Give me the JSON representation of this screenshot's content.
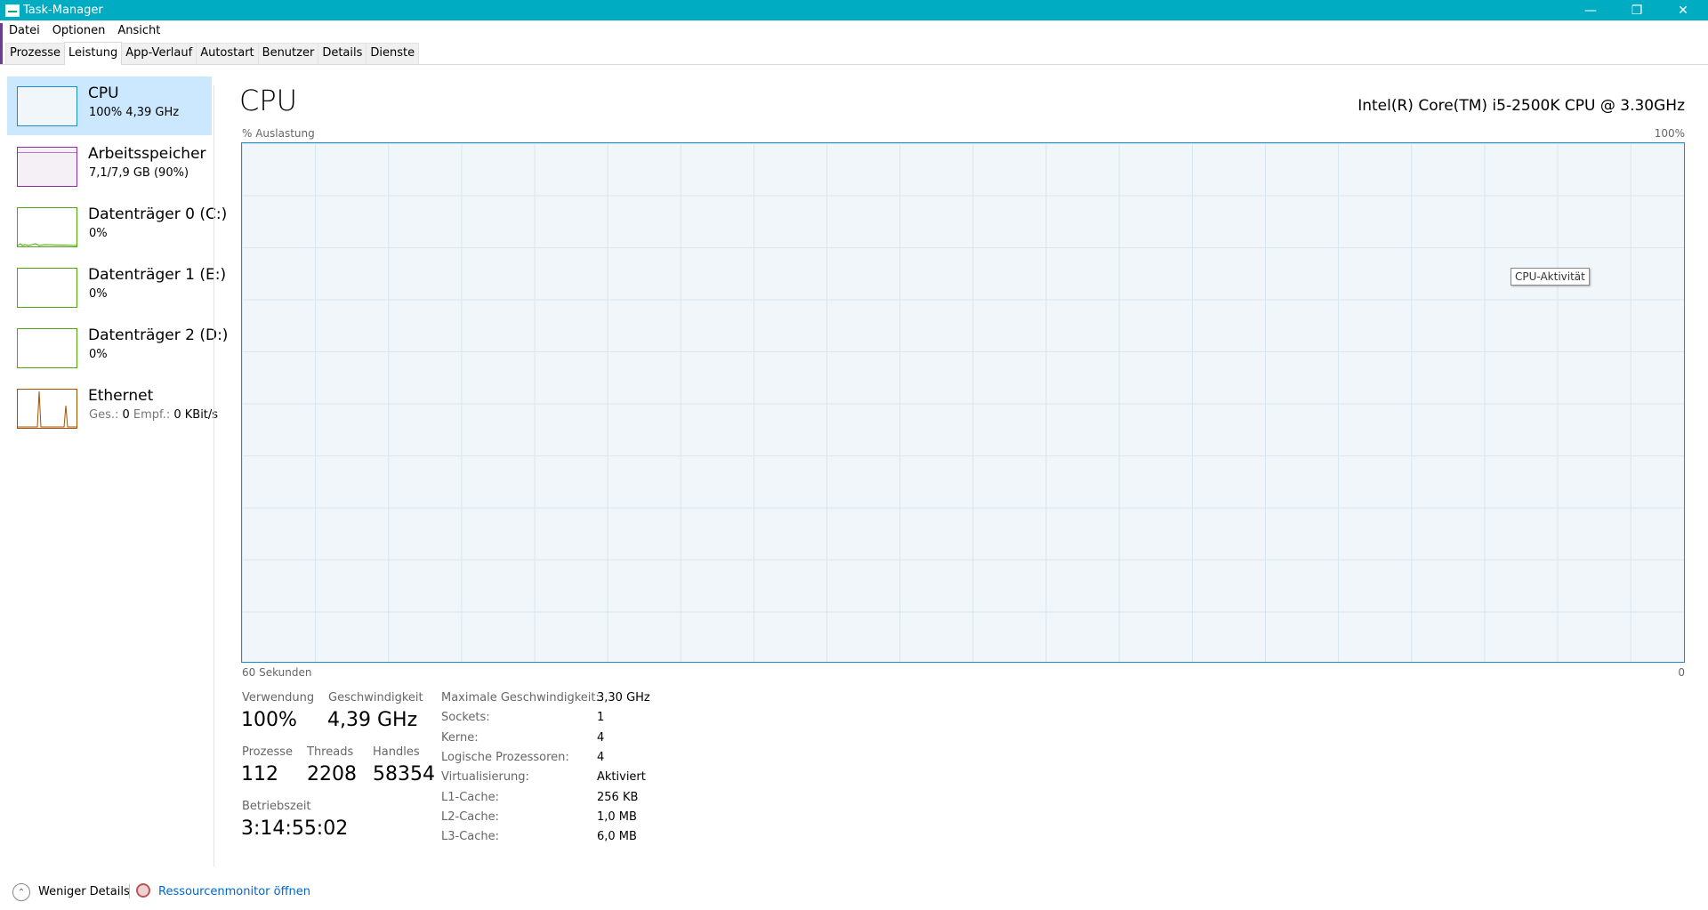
{
  "window": {
    "title": "Task-Manager",
    "minimize_glyph": "—",
    "restore_glyph": "❐",
    "close_glyph": "✕"
  },
  "menu": [
    "Datei",
    "Optionen",
    "Ansicht"
  ],
  "tabs": [
    "Prozesse",
    "Leistung",
    "App-Verlauf",
    "Autostart",
    "Benutzer",
    "Details",
    "Dienste"
  ],
  "active_tab": "Leistung",
  "sidebar": [
    {
      "name": "CPU",
      "sub": "100%  4,39 GHz",
      "color": "#1a8bd1",
      "selected": true
    },
    {
      "name": "Arbeitsspeicher",
      "sub": "7,1/7,9 GB (90%)",
      "color": "#8b2ea0"
    },
    {
      "name": "Datenträger 0 (C:)",
      "sub": "0%",
      "color": "#4da60c"
    },
    {
      "name": "Datenträger 1 (E:)",
      "sub": "0%",
      "color": "#4da60c"
    },
    {
      "name": "Datenträger 2 (D:)",
      "sub": "0%",
      "color": "#4da60c"
    },
    {
      "name": "Ethernet",
      "sub_label1": "Ges.:",
      "sub_value1": "0",
      "sub_label2": "Empf.:",
      "sub_value2": "0 KBit/s",
      "color": "#a74f01"
    }
  ],
  "main": {
    "title": "CPU",
    "model": "Intel(R) Core(TM) i5-2500K CPU @ 3.30GHz",
    "axis_top_left": "% Auslastung",
    "axis_top_right": "100%",
    "axis_bottom_left": "60 Sekunden",
    "axis_bottom_right": "0",
    "tooltip": "CPU-Aktivität"
  },
  "stats": {
    "usage_label": "Verwendung",
    "usage_value": "100%",
    "speed_label": "Geschwindigkeit",
    "speed_value": "4,39 GHz",
    "processes_label": "Prozesse",
    "processes_value": "112",
    "threads_label": "Threads",
    "threads_value": "2208",
    "handles_label": "Handles",
    "handles_value": "58354",
    "uptime_label": "Betriebszeit",
    "uptime_value": "3:14:55:02"
  },
  "details": [
    {
      "label": "Maximale Geschwindigkeit:",
      "value": "3,30 GHz"
    },
    {
      "label": "Sockets:",
      "value": "1"
    },
    {
      "label": "Kerne:",
      "value": "4"
    },
    {
      "label": "Logische Prozessoren:",
      "value": "4"
    },
    {
      "label": "Virtualisierung:",
      "value": "Aktiviert"
    },
    {
      "label": "L1-Cache:",
      "value": "256 KB"
    },
    {
      "label": "L2-Cache:",
      "value": "1,0 MB"
    },
    {
      "label": "L3-Cache:",
      "value": "6,0 MB"
    }
  ],
  "footer": {
    "less_details": "Weniger Details",
    "resource_monitor": "Ressourcenmonitor öffnen"
  }
}
